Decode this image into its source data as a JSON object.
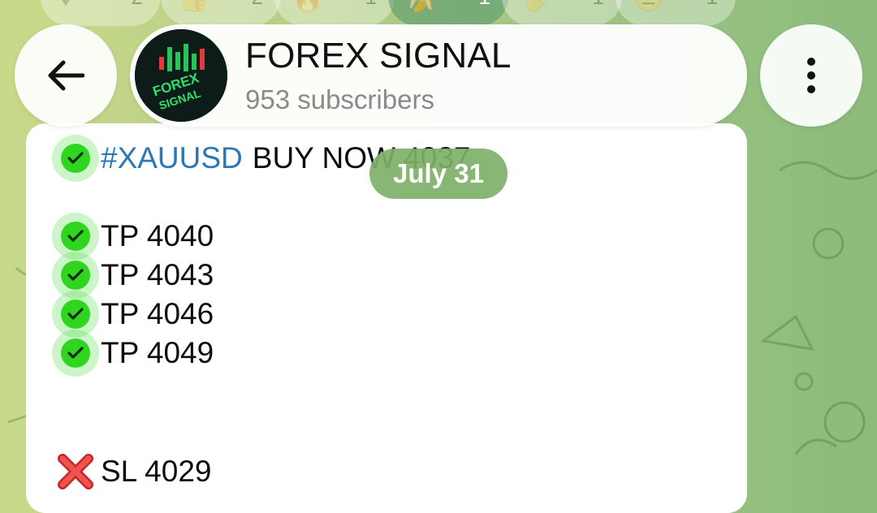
{
  "header": {
    "channel_name": "FOREX SIGNAL",
    "subscribers": "953 subscribers",
    "avatar_text": "FOREX SIGNAL"
  },
  "reactions": [
    {
      "count": "2"
    },
    {
      "count": "2"
    },
    {
      "count": "1"
    },
    {
      "count": "1"
    },
    {
      "count": "1"
    },
    {
      "count": "1"
    }
  ],
  "date_pill": "July 31",
  "message": {
    "hashtag": "#XAUUSD",
    "entry": "BUY NOW 4037",
    "tp_lines": [
      "TP 4040",
      "TP 4043",
      "TP 4046",
      "TP 4049"
    ],
    "sl_line": "SL 4029"
  },
  "colors": {
    "accent_hashtag": "#2b78b8",
    "check_green": "#2fd51f",
    "cross_red": "#e53935",
    "date_pill_bg": "#7eb068"
  }
}
